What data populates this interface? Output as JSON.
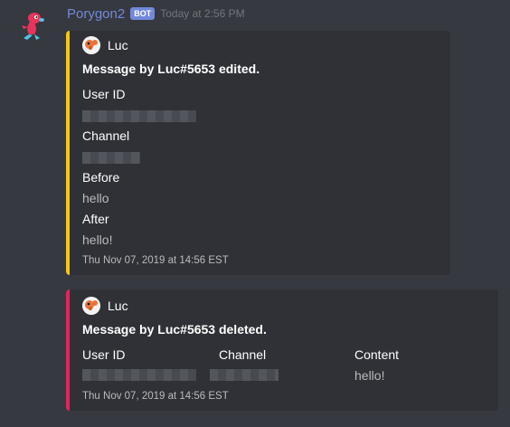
{
  "message": {
    "username": "Porygon2",
    "bot_tag": "BOT",
    "timestamp": "Today at 2:56 PM",
    "avatar_icon": "porygon2-avatar-icon"
  },
  "embeds": [
    {
      "color": "#f5c518",
      "author": "Luc",
      "title": "Message by Luc#5653 edited.",
      "fields": [
        {
          "name": "User ID",
          "value": ""
        },
        {
          "name": "Channel",
          "value": ""
        },
        {
          "name": "Before",
          "value": "hello"
        },
        {
          "name": "After",
          "value": "hello!"
        }
      ],
      "footer": "Thu Nov 07, 2019 at 14:56 EST"
    },
    {
      "color": "#e0245e",
      "author": "Luc",
      "title": "Message by Luc#5653 deleted.",
      "fields": [
        {
          "name": "User ID",
          "value": ""
        },
        {
          "name": "Channel",
          "value": ""
        },
        {
          "name": "Content",
          "value": "hello!"
        }
      ],
      "footer": "Thu Nov 07, 2019 at 14:56 EST"
    }
  ]
}
